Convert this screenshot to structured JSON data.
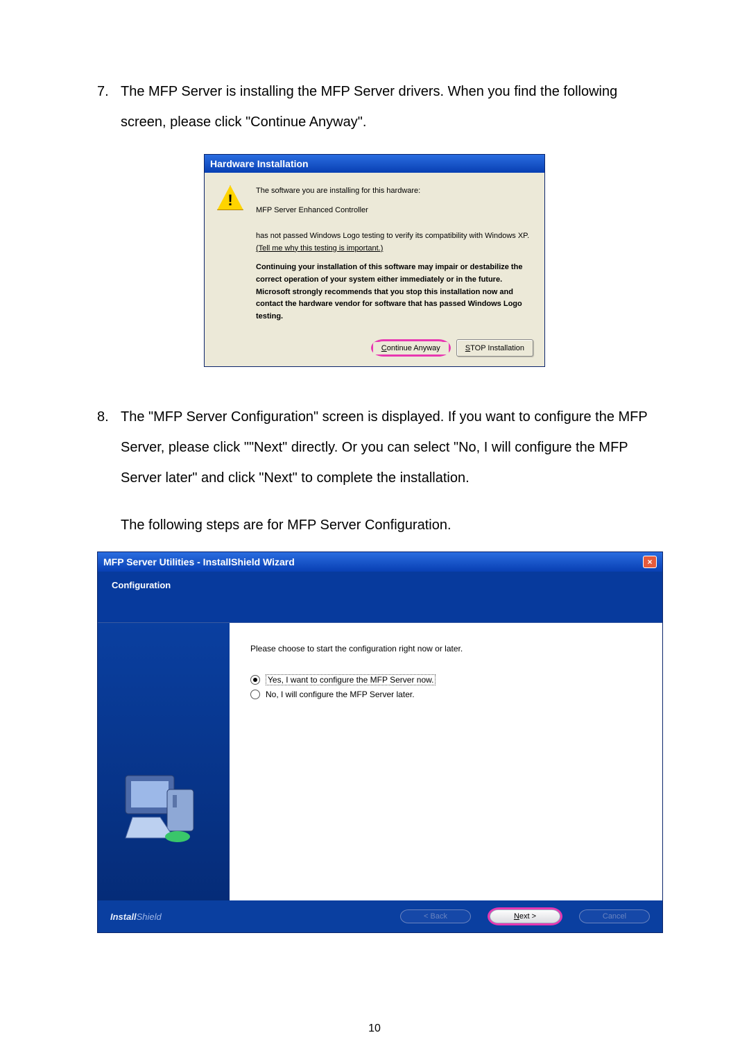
{
  "step7": {
    "num": "7.",
    "text": "The MFP Server is installing the MFP Server drivers. When you find the following screen, please click \"Continue Anyway\"."
  },
  "hw": {
    "title": "Hardware Installation",
    "line1": "The software you are installing for this hardware:",
    "device": "MFP Server Enhanced Controller",
    "compat_a": "has not passed Windows Logo testing to verify its compatibility with Windows XP. ",
    "compat_link": "(Tell me why this testing is important.)",
    "bold": "Continuing your installation of this software may impair or destabilize the correct operation of your system either immediately or in the future. Microsoft strongly recommends that you stop this installation now and contact the hardware vendor for software that has passed Windows Logo testing.",
    "btn_continue_pre": "C",
    "btn_continue_rest": "ontinue Anyway",
    "btn_stop_pre": "S",
    "btn_stop_rest": "TOP Installation"
  },
  "step8": {
    "num": "8.",
    "text": "The \"MFP Server Configuration\" screen is displayed. If you want to configure the MFP Server, please click \"\"Next\" directly. Or you can select \"No, I will configure the MFP Server later\" and click \"Next\" to complete the installation.",
    "after": "The following steps are for MFP Server Configuration."
  },
  "is": {
    "title": "MFP Server Utilities - InstallShield Wizard",
    "header": "Configuration",
    "prompt": "Please choose to start the configuration right now or later.",
    "opt_yes": "Yes, I want to configure the MFP Server now.",
    "opt_no": "No, I will configure the MFP Server later.",
    "brand_a": "Install",
    "brand_b": "Shield",
    "btn_back": "< Back",
    "btn_next_pre": "N",
    "btn_next_rest": "ext >",
    "btn_cancel": "Cancel"
  },
  "page_number": "10"
}
